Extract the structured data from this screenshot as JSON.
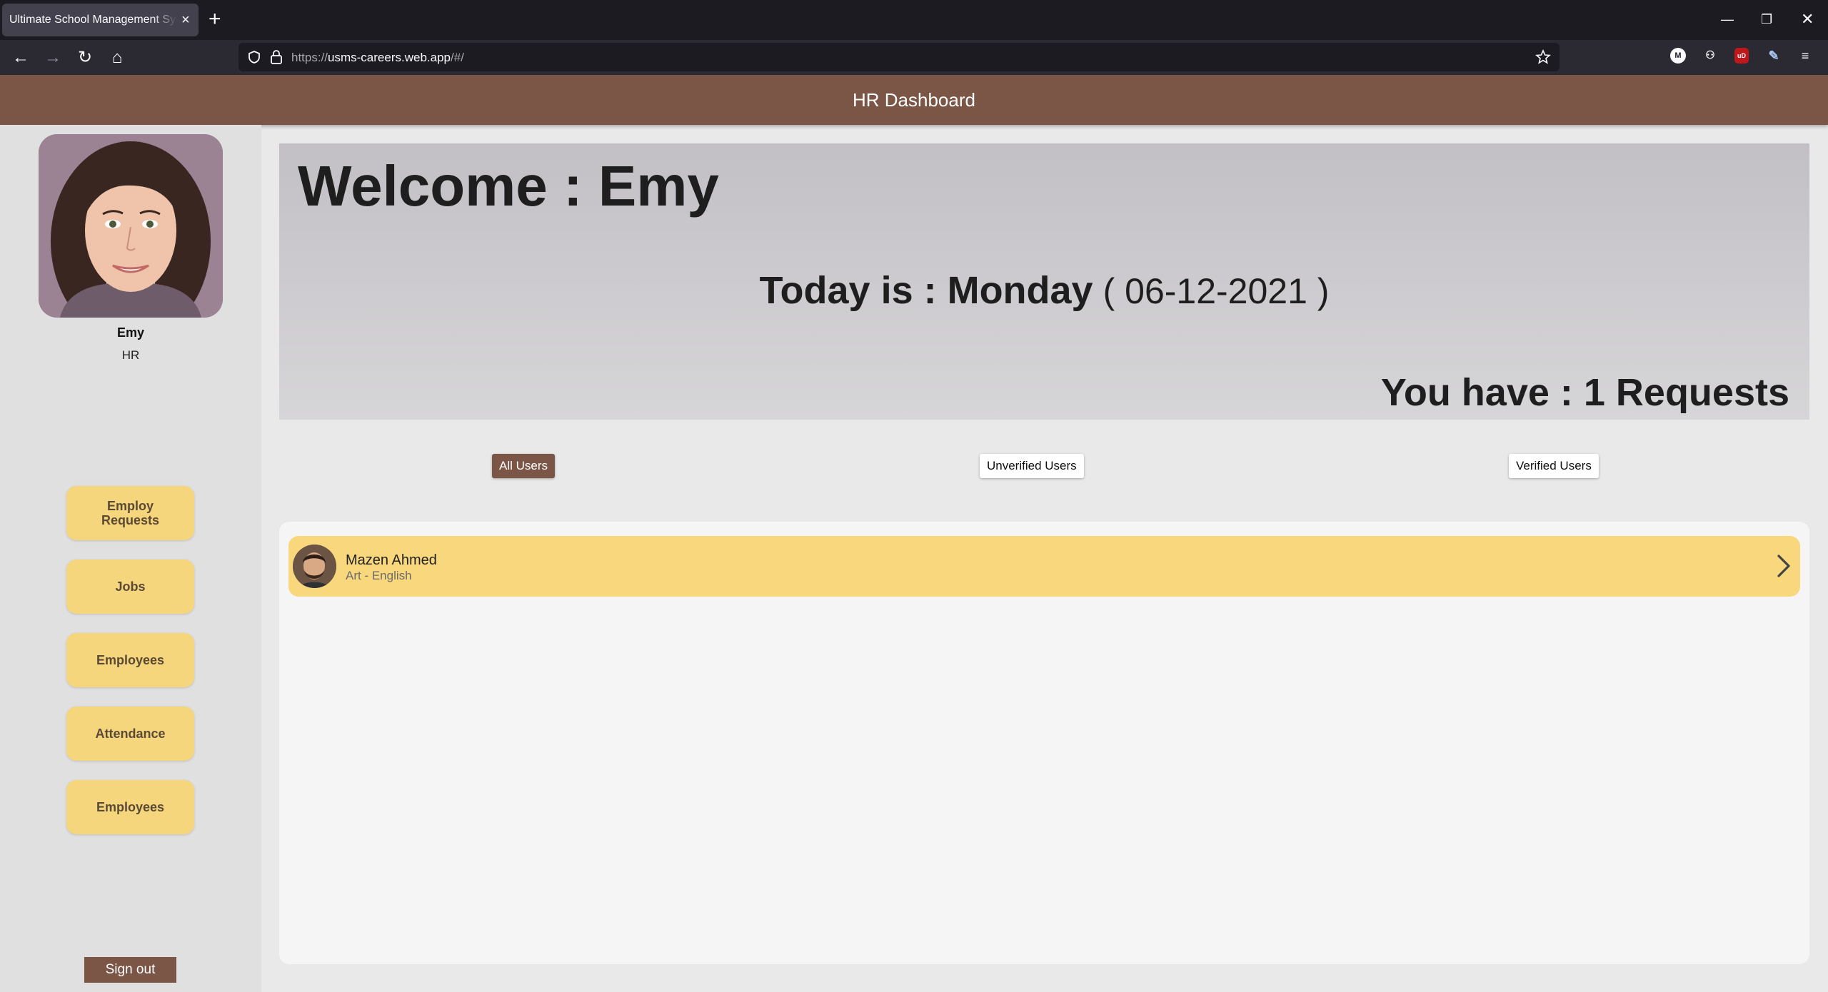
{
  "browser": {
    "tab_title": "Ultimate School Management System",
    "url_prefix": "https://",
    "url_host": "usms-careers.web.app",
    "url_path": "/#/"
  },
  "app": {
    "header_title": "HR Dashboard"
  },
  "profile": {
    "name": "Emy",
    "role": "HR"
  },
  "sidebar": {
    "buttons": [
      {
        "label": "Employ Requests"
      },
      {
        "label": "Jobs"
      },
      {
        "label": "Employees"
      },
      {
        "label": "Attendance"
      },
      {
        "label": "Employees"
      }
    ],
    "signout_label": "Sign out"
  },
  "welcome": {
    "greeting": "Welcome : Emy",
    "today_label": "Today is : Monday",
    "date": "( 06-12-2021 )",
    "requests": "You have : 1 Requests"
  },
  "filters": {
    "all": "All Users",
    "unverified": "Unverified Users",
    "verified": "Verified Users"
  },
  "users": [
    {
      "name": "Mazen Ahmed",
      "subtitle": "Art - English"
    }
  ],
  "colors": {
    "brand": "#7b5646",
    "accent": "#f6d67d"
  }
}
